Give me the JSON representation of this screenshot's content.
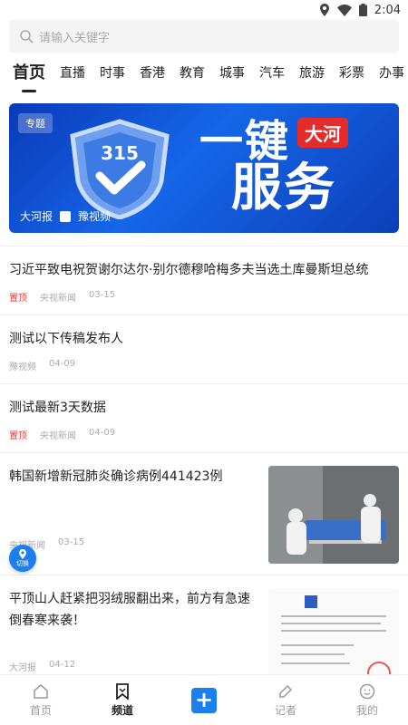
{
  "status": {
    "time": "2:04"
  },
  "search": {
    "placeholder": "请输入关键字"
  },
  "tabs": [
    "首页",
    "直播",
    "时事",
    "香港",
    "教育",
    "城事",
    "汽车",
    "旅游",
    "彩票",
    "办事"
  ],
  "banner": {
    "tag": "专题",
    "badge": "大河",
    "line1": "一键",
    "line2": "服务",
    "shield_text": "315",
    "logo1": "大河报",
    "logo2": "豫视频"
  },
  "feed": [
    {
      "title": "习近平致电祝贺谢尔达尔·别尔德穆哈梅多夫当选土库曼斯坦总统",
      "pin": "置顶",
      "source": "央视新闻",
      "date": "03-15"
    },
    {
      "title": "测试以下传稿发布人",
      "pin": "",
      "source": "豫视频",
      "date": "04-09"
    },
    {
      "title": "测试最新3天数据",
      "pin": "置顶",
      "source": "央视新闻",
      "date": "04-09"
    },
    {
      "title": "韩国新增新冠肺炎确诊病例441423例",
      "pin": "",
      "source": "央视新闻",
      "date": "03-15"
    },
    {
      "title": "平顶山人赶紧把羽绒服翻出来，前方有急速倒春寒来袭！",
      "pin": "",
      "source": "大河报",
      "date": "04-12"
    }
  ],
  "switch_label": "切换",
  "bottom_nav": [
    "首页",
    "频道",
    "",
    "记者",
    "我的"
  ],
  "colors": {
    "accent": "#1b7ff0",
    "pin": "#e33333",
    "banner": "#1566e8"
  }
}
